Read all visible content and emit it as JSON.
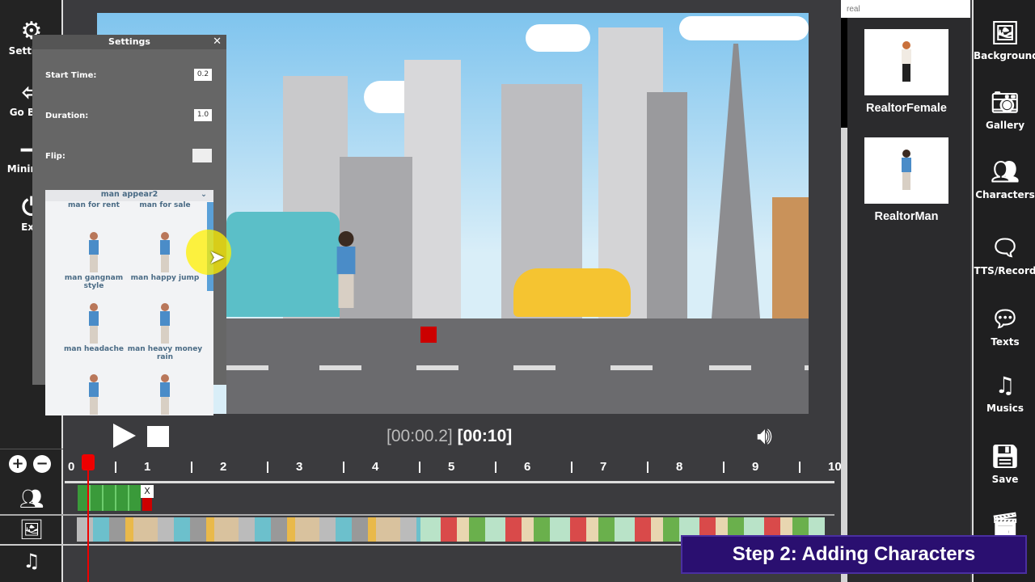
{
  "left_sidebar": {
    "items": [
      {
        "label": "Settings",
        "icon": "gear-icon"
      },
      {
        "label": "Go Back",
        "icon": "go-back-icon"
      },
      {
        "label": "Minimize",
        "icon": "minimize-icon"
      },
      {
        "label": "Exit",
        "icon": "power-icon"
      }
    ]
  },
  "settings_dialog": {
    "title": "Settings",
    "close": "✕",
    "start_time_label": "Start Time:",
    "start_time": "0.2",
    "duration_label": "Duration:",
    "duration": "1.0",
    "flip_label": "Flip:",
    "flip": ""
  },
  "animation_list": {
    "selected": "man appear2",
    "items": [
      "man for rent",
      "man for sale",
      "man gangnam style",
      "man happy jump",
      "man headache",
      "man heavy money rain"
    ]
  },
  "playback": {
    "current_time": "[00:00.2]",
    "total_time": "[00:10]"
  },
  "timeline": {
    "ticks": [
      "0",
      "1",
      "2",
      "3",
      "4",
      "5",
      "6",
      "7",
      "8",
      "9",
      "10"
    ],
    "playhead_seconds": 0.2,
    "clip_close": "X"
  },
  "asset_search": {
    "value": "real"
  },
  "assets": [
    {
      "label": "RealtorFemale"
    },
    {
      "label": "RealtorMan"
    }
  ],
  "right_toolbar": {
    "items": [
      {
        "label": "Backgrounds",
        "icon": "image-icon"
      },
      {
        "label": "Gallery",
        "icon": "camera-icon"
      },
      {
        "label": "Characters",
        "icon": "people-icon"
      },
      {
        "label": "TTS/Record",
        "icon": "speech-person-icon"
      },
      {
        "label": "Texts",
        "icon": "speech-bubble-icon"
      },
      {
        "label": "Musics",
        "icon": "music-icon"
      },
      {
        "label": "Save",
        "icon": "save-icon"
      },
      {
        "label": "",
        "icon": "video-icon"
      }
    ]
  },
  "banner": {
    "text": "Step 2: Adding Characters"
  },
  "colors": {
    "accent_red": "#e00000",
    "banner": "#2a0f70"
  }
}
